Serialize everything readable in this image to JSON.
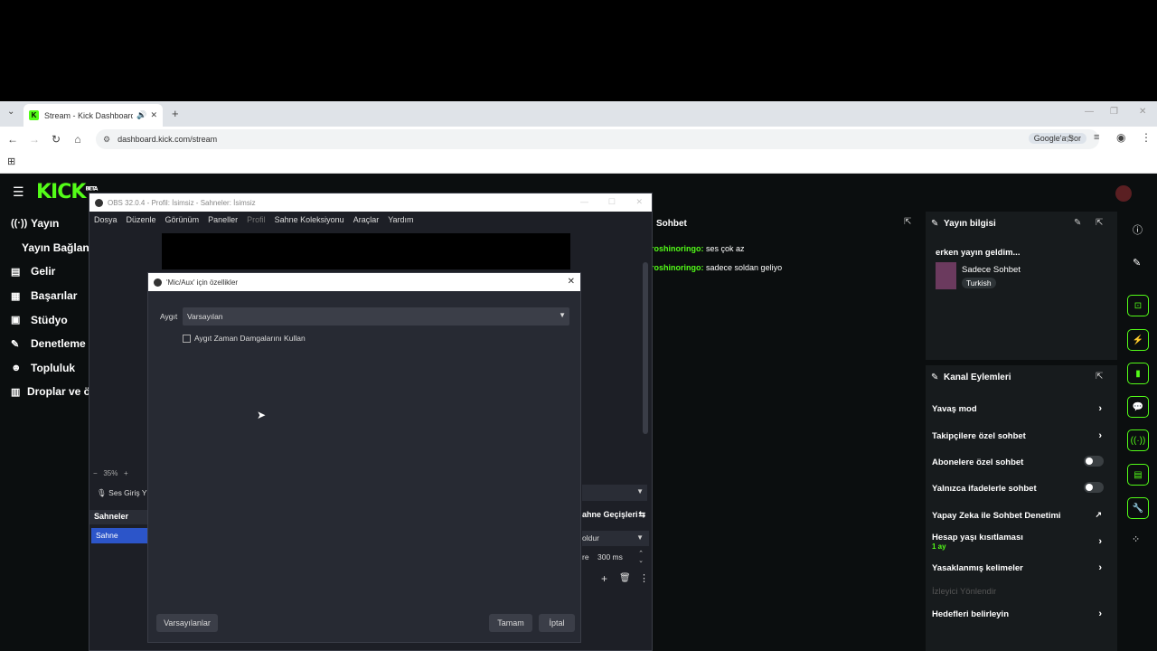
{
  "browser": {
    "tab_title": "Stream - Kick Dashboard",
    "url": "dashboard.kick.com/stream",
    "google_sor": "Google'a Sor"
  },
  "kick": {
    "logo": "KICK",
    "logo_beta": "BETA",
    "sidebar": [
      {
        "label": "Yayın",
        "icon": "broadcast-icon"
      },
      {
        "label": "Yayın Bağlantıs",
        "icon": ""
      },
      {
        "label": "Gelir",
        "icon": "revenue-icon"
      },
      {
        "label": "Başarılar",
        "icon": "achievements-icon"
      },
      {
        "label": "Stüdyo",
        "icon": "studio-icon"
      },
      {
        "label": "Denetleme",
        "icon": "moderation-icon"
      },
      {
        "label": "Topluluk",
        "icon": "community-icon"
      },
      {
        "label": "Droplar ve ö",
        "icon": "drops-icon"
      }
    ],
    "chat": {
      "title": "Sohbet",
      "messages": [
        {
          "user": "roshinoringo:",
          "text": "ses çok az"
        },
        {
          "user": "roshinoringo:",
          "text": "sadece soldan geliyo"
        }
      ]
    },
    "info": {
      "title": "Yayın bilgisi",
      "stream_title": "erken yayın geldim...",
      "category": "Sadece Sohbet",
      "language": "Turkish"
    },
    "actions": {
      "title": "Kanal Eylemleri",
      "slow_mode": "Yavaş mod",
      "followers_only": "Takipçilere özel sohbet",
      "subscribers_only": "Abonelere özel sohbet",
      "emotes_only": "Yalnızca ifadelerle sohbet",
      "ai_moderation": "Yapay Zeka ile Sohbet Denetimi",
      "account_age": "Hesap yaşı kısıtlaması",
      "account_age_value": "1 ay",
      "banned_words": "Yasaklanmış kelimeler",
      "viewer_redirect": "İzleyici Yönlendir",
      "set_goals": "Hedefleri belirleyin"
    }
  },
  "obs": {
    "title": "OBS 32.0.4 - Profil: İsimsiz - Sahneler: İsimsiz",
    "menu": [
      "Dosya",
      "Düzenle",
      "Görünüm",
      "Paneller",
      "Profil",
      "Sahne Koleksiyonu",
      "Araçlar",
      "Yardım"
    ],
    "zoom": "35%",
    "audio_source": "Ses Giriş Y",
    "scenes_header": "Sahneler",
    "scene_item": "Sahne",
    "transitions_header": "ahne Geçişleri",
    "transition_value": "oldur",
    "duration_label": "re",
    "duration_value": "300 ms"
  },
  "dialog": {
    "title": "'Mic/Aux' için özellikler",
    "device_label": "Aygıt",
    "device_value": "Varsayılan",
    "timestamp_checkbox": "Aygıt Zaman Damgalarını Kullan",
    "defaults_button": "Varsayılanlar",
    "ok_button": "Tamam",
    "cancel_button": "İptal"
  }
}
